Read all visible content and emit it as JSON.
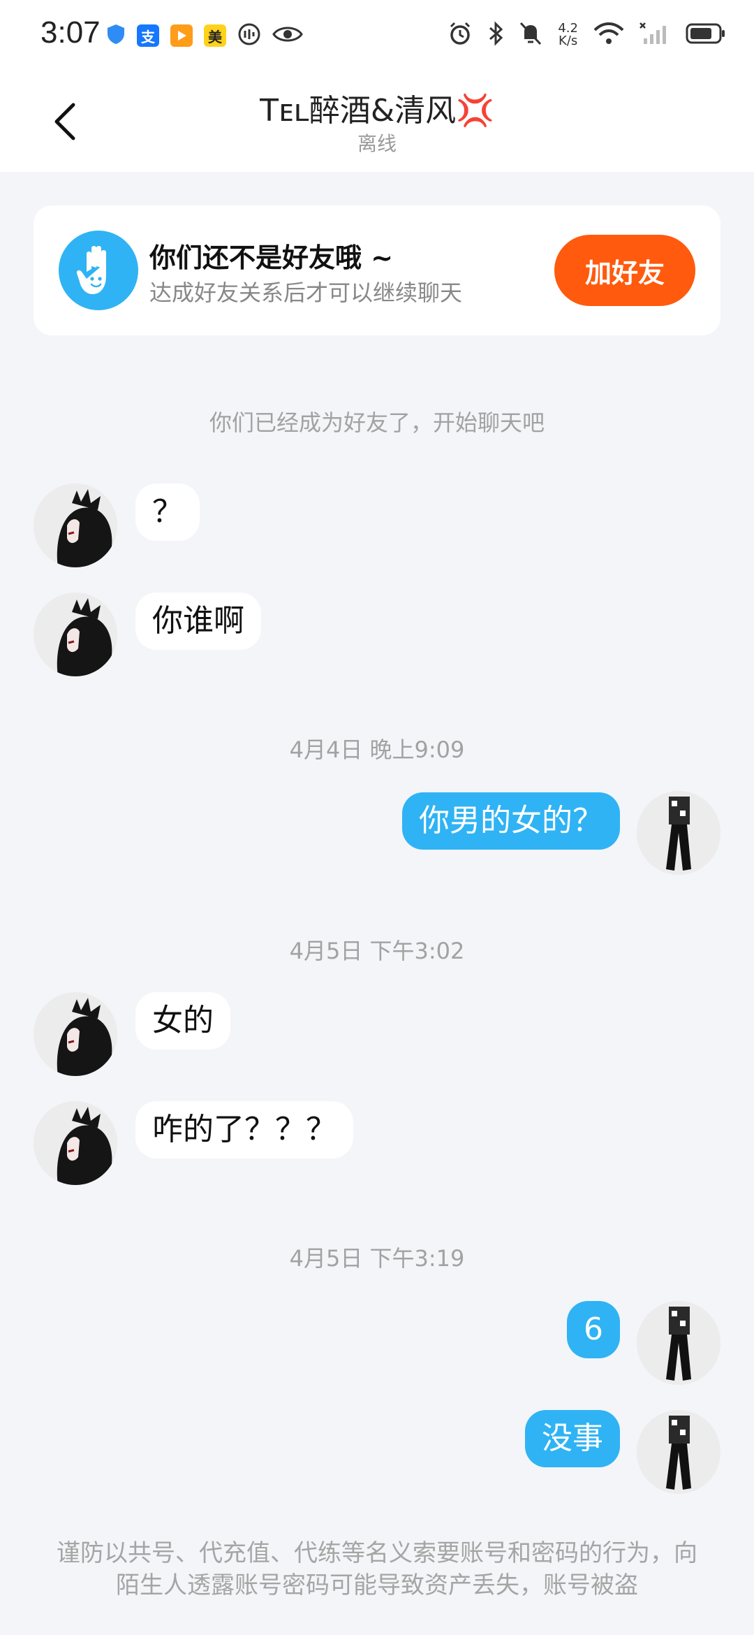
{
  "status_bar": {
    "time": "3:07",
    "left_icons": [
      "shield-icon",
      "alipay-icon",
      "video-icon",
      "meituan-icon",
      "recorder-icon",
      "eye-icon"
    ],
    "alipay_label": "支",
    "meituan_label": "美",
    "speed_value": "4.2",
    "speed_unit": "K/s",
    "right_icons": [
      "alarm-icon",
      "bluetooth-icon",
      "mute-icon",
      "wifi-icon",
      "signal-icon",
      "battery-icon"
    ]
  },
  "header": {
    "title": "Tᴇʟ醉酒&清风💢",
    "status": "离线"
  },
  "friend_notice": {
    "title": "你们还不是好友哦 ~",
    "subtitle": "达成好友关系后才可以继续聊天",
    "button_label": "加好友"
  },
  "system_message": "你们已经成为好友了，开始聊天吧",
  "timestamps": {
    "t1": "4月4日 晚上9:09",
    "t2": "4月5日 下午3:02",
    "t3": "4月5日 下午3:19"
  },
  "messages": [
    {
      "side": "in",
      "text": "？"
    },
    {
      "side": "in",
      "text": "你谁啊"
    },
    {
      "side": "out",
      "text": "你男的女的？"
    },
    {
      "side": "in",
      "text": "女的"
    },
    {
      "side": "in",
      "text": "咋的了？？？"
    },
    {
      "side": "out",
      "text": "6"
    },
    {
      "side": "out",
      "text": "没事"
    }
  ],
  "warning": "谨防以共号、代充值、代练等名义索要账号和密码的行为，向陌生人透露账号密码可能导致资产丢失，账号被盗",
  "colors": {
    "accent_blue": "#2fb3f4",
    "add_friend_orange": "#ff5a0d",
    "background": "#f3f5f8"
  }
}
